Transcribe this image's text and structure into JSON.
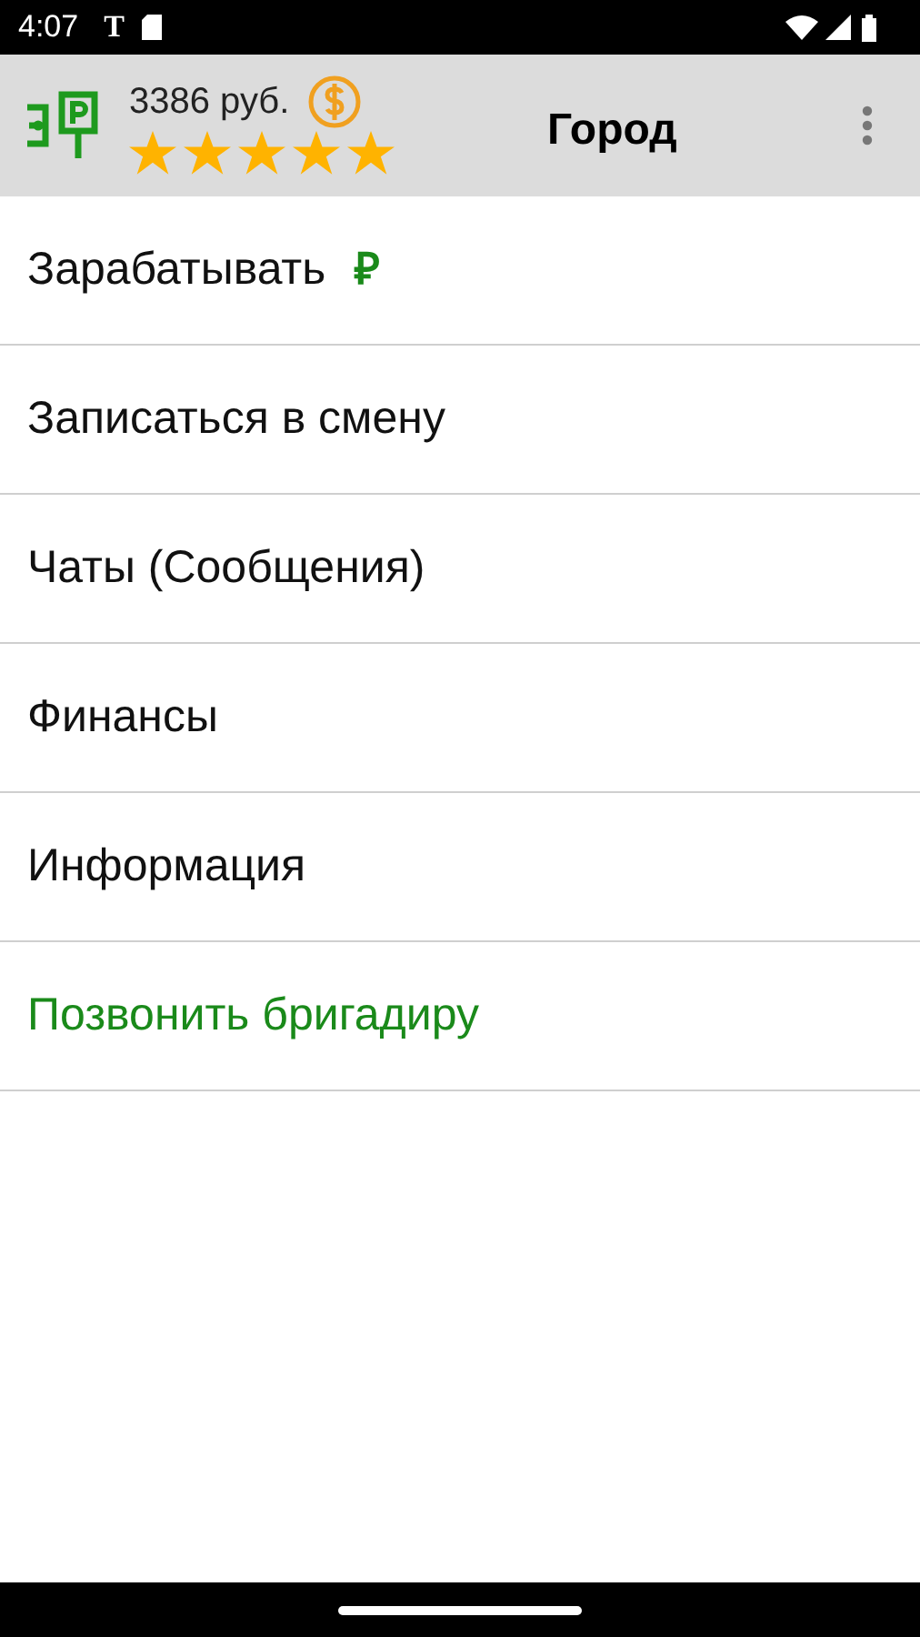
{
  "status_bar": {
    "time": "4:07",
    "carrier_glyph": "T"
  },
  "header": {
    "balance": "3386 руб.",
    "stars": 5,
    "title": "Город"
  },
  "menu": [
    {
      "label": "Зарабатывать",
      "kind": "normal",
      "badge": "₽"
    },
    {
      "label": "Записаться в смену",
      "kind": "normal"
    },
    {
      "label": "Чаты (Сообщения)",
      "kind": "normal"
    },
    {
      "label": "Финансы",
      "kind": "normal"
    },
    {
      "label": "Информация",
      "kind": "normal"
    },
    {
      "label": "Позвонить бригадиру",
      "kind": "action"
    }
  ]
}
